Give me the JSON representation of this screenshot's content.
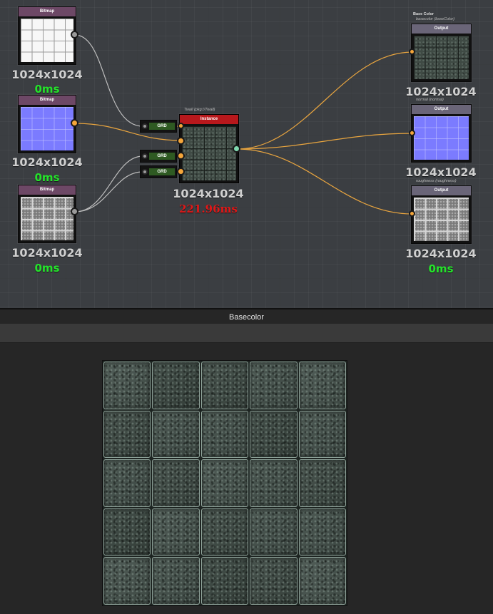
{
  "graph": {
    "inputs": [
      {
        "header": "Bitmap",
        "resolution": "1024x1024",
        "time": "0ms"
      },
      {
        "header": "Bitmap",
        "resolution": "1024x1024",
        "time": "0ms"
      },
      {
        "header": "Bitmap",
        "resolution": "1024x1024",
        "time": "0ms"
      }
    ],
    "grd_nodes": [
      {
        "label": "GRD"
      },
      {
        "label": "GRD"
      },
      {
        "label": "GRD"
      }
    ],
    "instance": {
      "caption": "Twall (pkg://Twall)",
      "header": "Instance",
      "resolution": "1024x1024",
      "time": "221.96ms"
    },
    "outputs": [
      {
        "caption_main": "Base Color",
        "caption_sub": "basecolor (baseColor)",
        "header": "Output",
        "resolution": "1024x1024",
        "time": "0ms"
      },
      {
        "caption_main": "",
        "caption_sub": "normal (normal)",
        "header": "Output",
        "resolution": "1024x1024",
        "time": "0ms"
      },
      {
        "caption_main": "",
        "caption_sub": "roughness (roughness)",
        "header": "Output",
        "resolution": "1024x1024",
        "time": "0ms"
      }
    ],
    "wire_colors": {
      "gray": "#bdbdbd",
      "orange": "#e9a53f"
    }
  },
  "viewer": {
    "title": "Basecolor"
  }
}
